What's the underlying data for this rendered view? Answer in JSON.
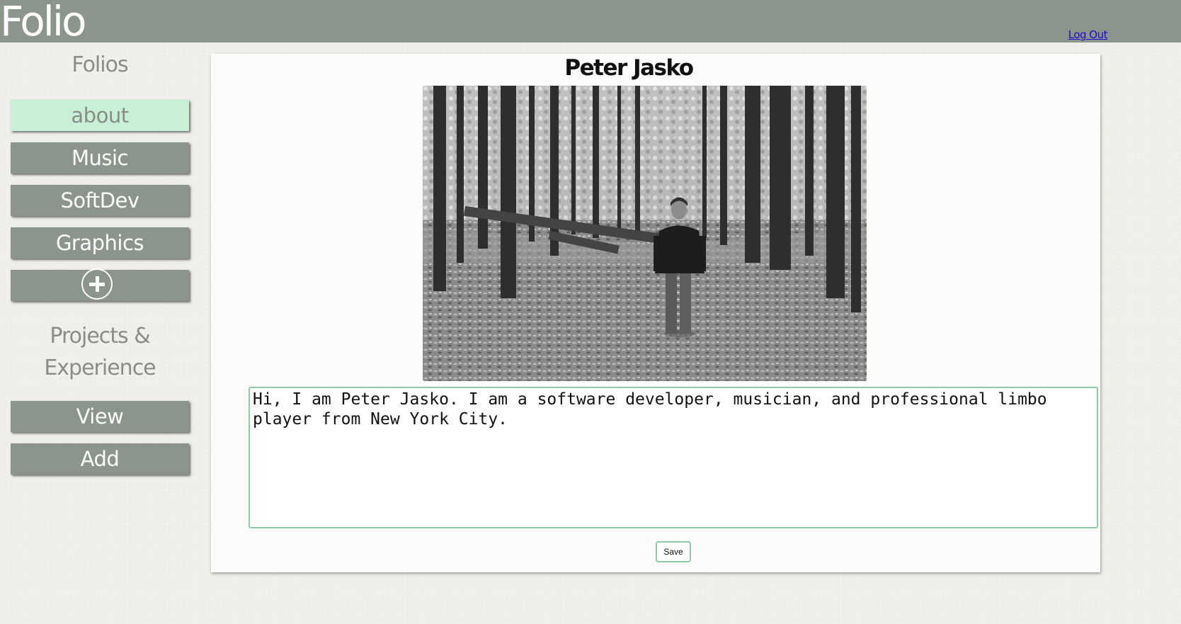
{
  "header": {
    "logo": "Folio",
    "logout_label": "Log Out"
  },
  "sidebar": {
    "folios_heading": "Folios",
    "folio_items": [
      {
        "label": "about",
        "active": true
      },
      {
        "label": "Music"
      },
      {
        "label": "SoftDev"
      },
      {
        "label": "Graphics"
      }
    ],
    "add_folio_icon": "plus-circle-icon",
    "projects_heading_line1": "Projects &",
    "projects_heading_line2": "Experience",
    "project_items": [
      {
        "label": "View"
      },
      {
        "label": "Add"
      }
    ]
  },
  "main": {
    "title": "Peter Jasko",
    "bio": "Hi, I am Peter Jasko. I am a software developer, musician, and professional limbo player from New York City.",
    "save_label": "Save"
  },
  "colors": {
    "header_bg": "#8c958b",
    "active_item_bg": "#c8f0d4",
    "accent_border": "#8ec9a8",
    "link": "#1a0dcc"
  }
}
